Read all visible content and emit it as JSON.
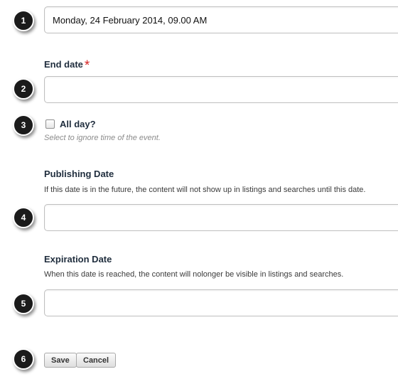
{
  "steps": [
    "1",
    "2",
    "3",
    "4",
    "5",
    "6"
  ],
  "start_date": {
    "value": "Monday, 24 February 2014, 09.00 AM"
  },
  "end_date": {
    "label": "End date",
    "required_mark": "*",
    "value": ""
  },
  "all_day": {
    "label": "All day?",
    "hint": "Select to ignore time of the event.",
    "checked": false
  },
  "publishing_date": {
    "label": "Publishing Date",
    "help": "If this date is in the future, the content will not show up in listings and searches until this date.",
    "value": ""
  },
  "expiration_date": {
    "label": "Expiration Date",
    "help": "When this date is reached, the content will nolonger be visible in listings and searches.",
    "value": ""
  },
  "buttons": {
    "save": "Save",
    "cancel": "Cancel"
  }
}
